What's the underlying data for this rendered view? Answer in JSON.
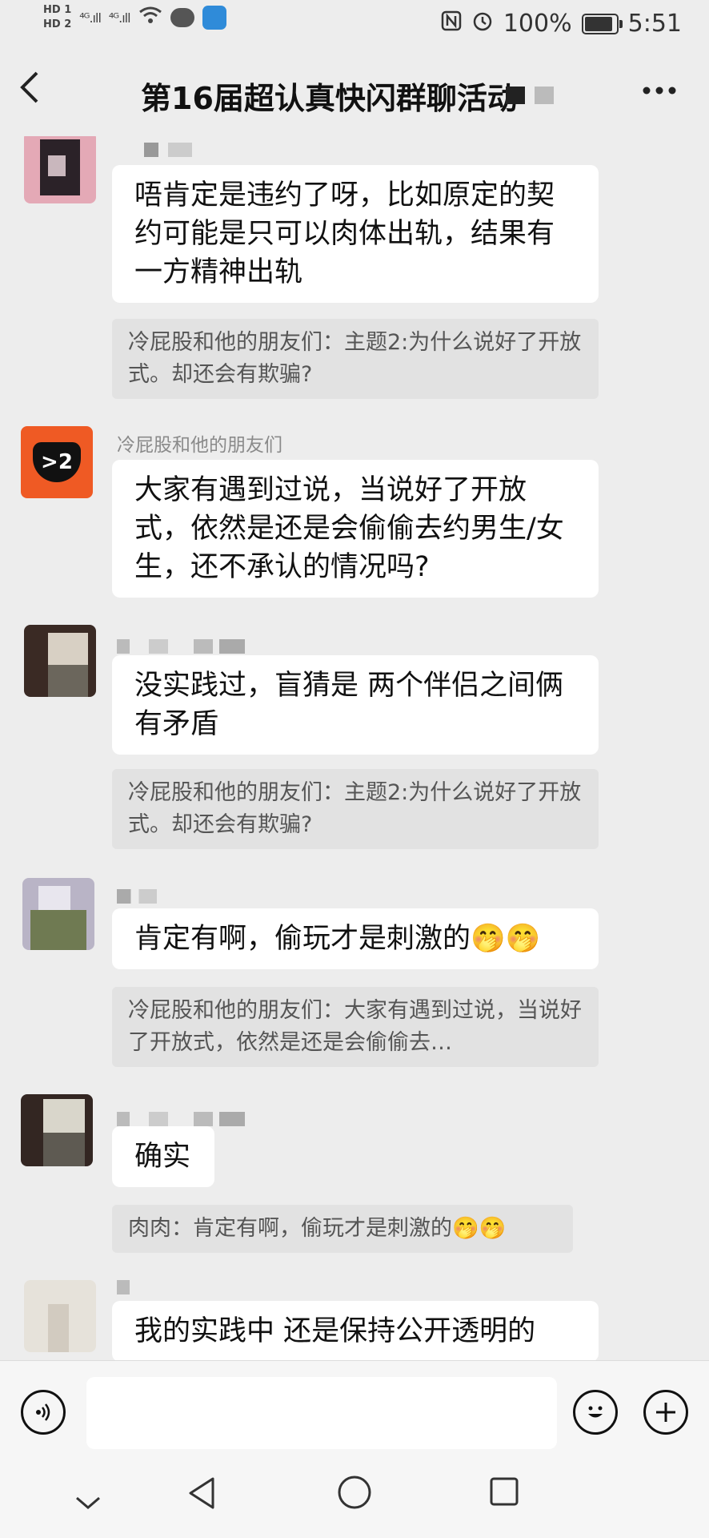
{
  "status_bar": {
    "hd1": "HD 1",
    "hd2": "HD 2",
    "sig1": "⁴ᴳ.ıll",
    "sig2": "⁴ᴳ.ıll",
    "battery_text": "100%",
    "time": "5:51",
    "battery_level": 1.0
  },
  "header": {
    "back_icon": "chevron-left-icon",
    "title": "第16届超认真快闪群聊活动",
    "more_icon": "more-horizontal-icon",
    "back_glyph": "‹",
    "more_glyph": "···"
  },
  "messages": [
    {
      "text": "唔肯定是违约了呀，比如原定的契约可能是只可以肉体出轨，结果有一方精神出轨",
      "quote": "冷屁股和他的朋友们：主题2:为什么说好了开放式。却还会有欺骗?"
    },
    {
      "sender": "冷屁股和他的朋友们",
      "avatar_text": ">2",
      "text": "大家有遇到过说，当说好了开放式，依然是还是会偷偷去约男生/女生，还不承认的情况吗?"
    },
    {
      "text": "没实践过，盲猜是  两个伴侣之间俩有矛盾",
      "quote": "冷屁股和他的朋友们：主题2:为什么说好了开放式。却还会有欺骗?"
    },
    {
      "text": "肯定有啊，偷玩才是刺激的🤭🤭",
      "quote": "冷屁股和他的朋友们：大家有遇到过说，当说好了开放式，依然是还是会偷偷去…"
    },
    {
      "text": "确实",
      "quote": "肉肉：肯定有啊，偷玩才是刺激的🤭🤭"
    },
    {
      "text": "我的实践中 还是保持公开透明的"
    }
  ],
  "input_bar": {
    "voice_icon": "voice-icon",
    "emoji_icon": "emoji-icon",
    "plus_icon": "plus-icon",
    "voice_glyph": "◉)",
    "emoji_glyph": "☺",
    "plus_glyph": "+"
  },
  "nav_bar": {
    "back_glyph": "◁",
    "home_glyph": "○",
    "recent_glyph": "□",
    "collapse_glyph": "⌄"
  }
}
